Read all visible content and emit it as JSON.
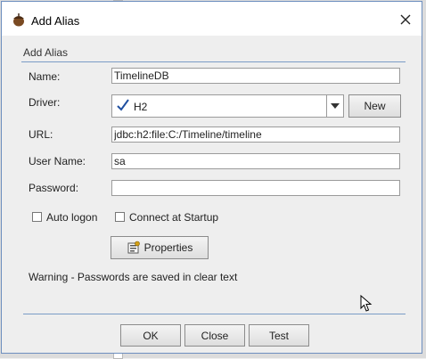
{
  "window": {
    "title": "Add Alias"
  },
  "group": {
    "title": "Add Alias"
  },
  "form": {
    "name_label": "Name:",
    "name_value": "TimelineDB",
    "driver_label": "Driver:",
    "driver_value": "H2",
    "new_button": "New",
    "url_label": "URL:",
    "url_value": "jdbc:h2:file:C:/Timeline/timeline",
    "user_label": "User Name:",
    "user_value": "sa",
    "password_label": "Password:",
    "password_value": ""
  },
  "options": {
    "auto_logon": "Auto logon",
    "connect_startup": "Connect at Startup",
    "properties_button": "Properties"
  },
  "warning": "Warning - Passwords are saved in clear text",
  "buttons": {
    "ok": "OK",
    "close": "Close",
    "test": "Test"
  },
  "icons": {
    "app": "acorn-icon",
    "close": "close-icon",
    "driver_check": "checkmark-icon",
    "dropdown": "chevron-down-icon",
    "properties": "properties-icon",
    "cursor": "mouse-pointer-icon"
  }
}
